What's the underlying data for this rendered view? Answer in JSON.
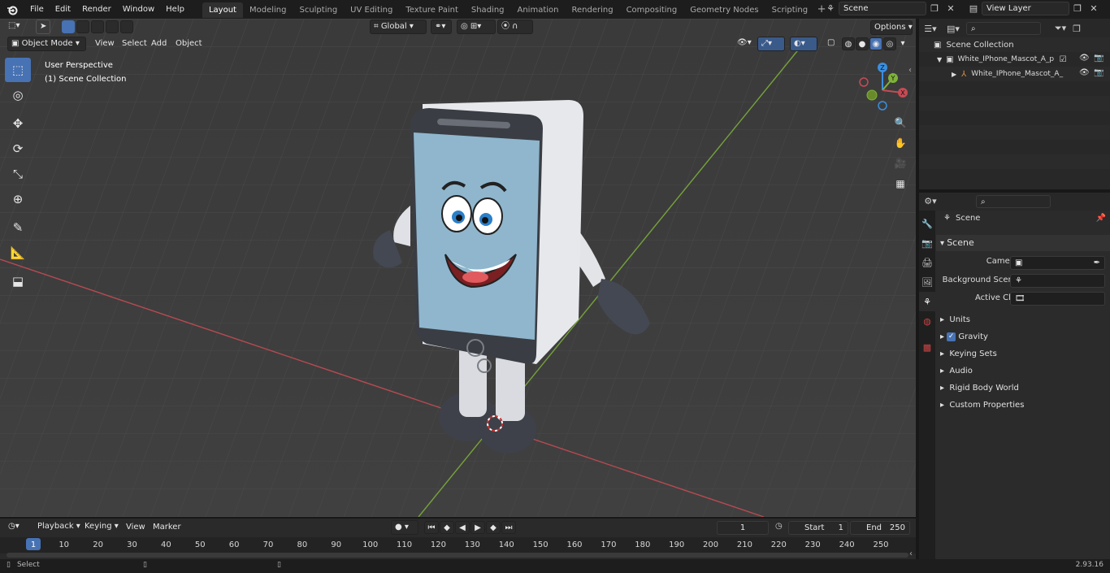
{
  "menu": {
    "items": [
      "File",
      "Edit",
      "Render",
      "Window",
      "Help"
    ]
  },
  "workspaces": [
    "Layout",
    "Modeling",
    "Sculpting",
    "UV Editing",
    "Texture Paint",
    "Shading",
    "Animation",
    "Rendering",
    "Compositing",
    "Geometry Nodes",
    "Scripting"
  ],
  "active_workspace": "Layout",
  "scene_field": "Scene",
  "view_layer_field": "View Layer",
  "viewport": {
    "mode": "Object Mode",
    "menus": [
      "View",
      "Select",
      "Add",
      "Object"
    ],
    "orientation": "Global",
    "options": "Options",
    "overlay_title": "User Perspective",
    "overlay_subtitle": "(1) Scene Collection",
    "axis_labels": {
      "z": "Z",
      "y": "Y",
      "x": "X"
    }
  },
  "outliner": {
    "search_placeholder": "",
    "items": [
      {
        "label": "Scene Collection"
      },
      {
        "label": "White_IPhone_Mascot_A_pose"
      },
      {
        "label": "White_IPhone_Mascot_A_"
      }
    ]
  },
  "properties": {
    "header": "Scene",
    "section": "Scene",
    "fields": [
      {
        "label": "Camera",
        "value": ""
      },
      {
        "label": "Background Scene",
        "value": ""
      },
      {
        "label": "Active Clip",
        "value": ""
      }
    ],
    "panels": [
      "Units",
      "Gravity",
      "Keying Sets",
      "Audio",
      "Rigid Body World",
      "Custom Properties"
    ],
    "gravity_checked": true
  },
  "timeline": {
    "menus": [
      "Playback",
      "Keying",
      "View",
      "Marker"
    ],
    "current_frame": "1",
    "start_label": "Start",
    "start_value": "1",
    "end_label": "End",
    "end_value": "250",
    "ticks": [
      "1",
      "10",
      "20",
      "30",
      "40",
      "50",
      "60",
      "70",
      "80",
      "90",
      "100",
      "110",
      "120",
      "130",
      "140",
      "150",
      "160",
      "170",
      "180",
      "190",
      "200",
      "210",
      "220",
      "230",
      "240",
      "250"
    ]
  },
  "status": {
    "left": "Select",
    "version": "2.93.16"
  },
  "colors": {
    "accent": "#4772b3",
    "x_axis": "#c64b55",
    "y_axis": "#7fb33a",
    "z_axis": "#3b8fe0"
  }
}
